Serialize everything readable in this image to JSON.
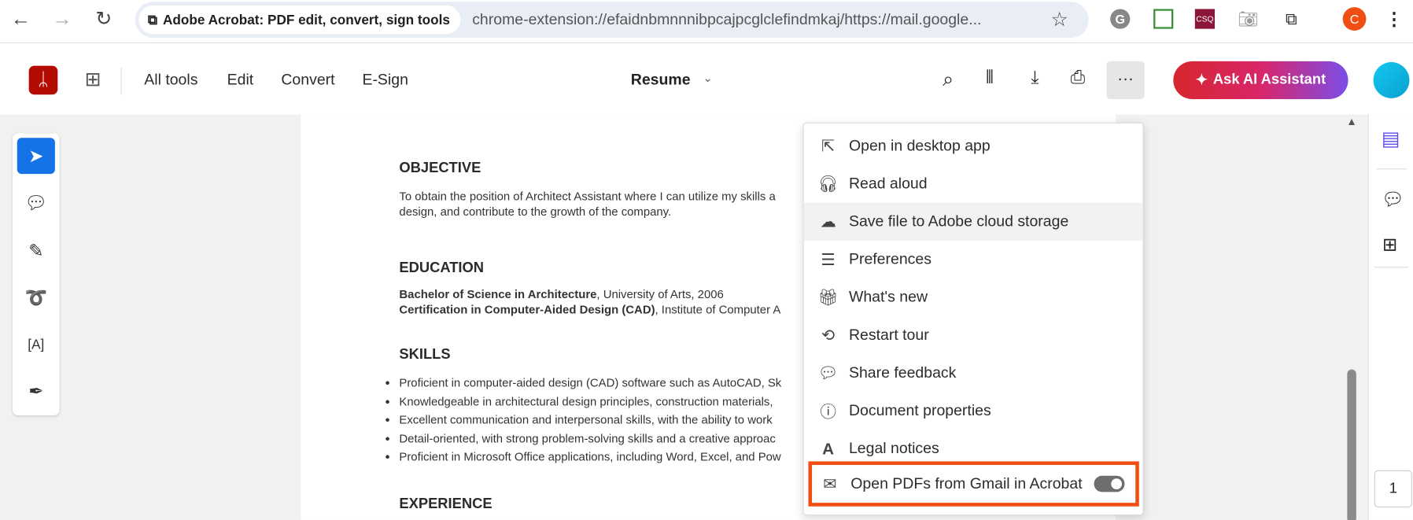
{
  "browser": {
    "site_chip": "Adobe Acrobat: PDF edit, convert, sign tools",
    "url": "chrome-extension://efaidnbmnnnibpcajpcglclefindmkaj/https://mail.google...",
    "profile_initial": "C",
    "ext_label": "CSQ"
  },
  "toolbar": {
    "tabs": [
      "All tools",
      "Edit",
      "Convert",
      "E-Sign"
    ],
    "doc_title": "Resume",
    "ai_button": "Ask AI Assistant"
  },
  "document": {
    "objective_h": "OBJECTIVE",
    "objective_lines": [
      "To obtain the position of Architect Assistant where I can utilize my skills a",
      "design, and contribute to the growth of the company."
    ],
    "education_h": "EDUCATION",
    "edu": [
      {
        "bold": "Bachelor of Science in Architecture",
        "rest": ", University of Arts, 2006"
      },
      {
        "bold": "Certification in Computer-Aided Design (CAD)",
        "rest": ", Institute of Computer A"
      }
    ],
    "skills_h": "SKILLS",
    "skills": [
      "Proficient in computer-aided design (CAD) software such as AutoCAD, Sk",
      "Knowledgeable in architectural design principles, construction materials,",
      "Excellent communication and interpersonal skills, with the ability to work",
      "Detail-oriented, with strong problem-solving skills and a creative approac",
      "Proficient in Microsoft Office applications, including Word, Excel, and Pow"
    ],
    "experience_h": "EXPERIENCE"
  },
  "menu": {
    "items": [
      "Open in desktop app",
      "Read aloud",
      "Save file to Adobe cloud storage",
      "Preferences",
      "What's new",
      "Restart tour",
      "Share feedback",
      "Document properties",
      "Legal notices"
    ],
    "toggle_item": "Open PDFs from Gmail in Acrobat",
    "toggle_on": true,
    "highlight_color": "#f04e12"
  },
  "page_number": "1"
}
